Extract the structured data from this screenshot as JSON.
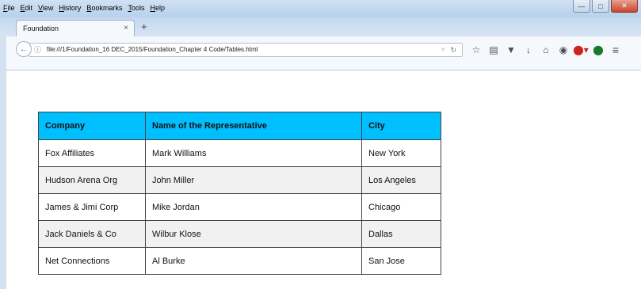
{
  "menu": [
    "File",
    "Edit",
    "View",
    "History",
    "Bookmarks",
    "Tools",
    "Help"
  ],
  "tab": {
    "title": "Foundation",
    "close": "×",
    "new_tab": "+"
  },
  "address": {
    "url": "file:///1/Foundation_16 DEC_2015/Foundation_Chapter 4 Code/Tables.html"
  },
  "table": {
    "headers": [
      "Company",
      "Name of the Representative",
      "City"
    ],
    "rows": [
      [
        "Fox Affiliates",
        "Mark Williams",
        "New York"
      ],
      [
        "Hudson Arena Org",
        "John Miller",
        "Los Angeles"
      ],
      [
        "James & Jimi Corp",
        "Mike Jordan",
        "Chicago"
      ],
      [
        "Jack Daniels & Co",
        "Wilbur Klose",
        "Dallas"
      ],
      [
        "Net Connections",
        "Al Burke",
        "San Jose"
      ]
    ]
  },
  "colors": {
    "header_bg": "#00bfff",
    "even_row_bg": "#f1f1f1",
    "border": "#444444"
  }
}
